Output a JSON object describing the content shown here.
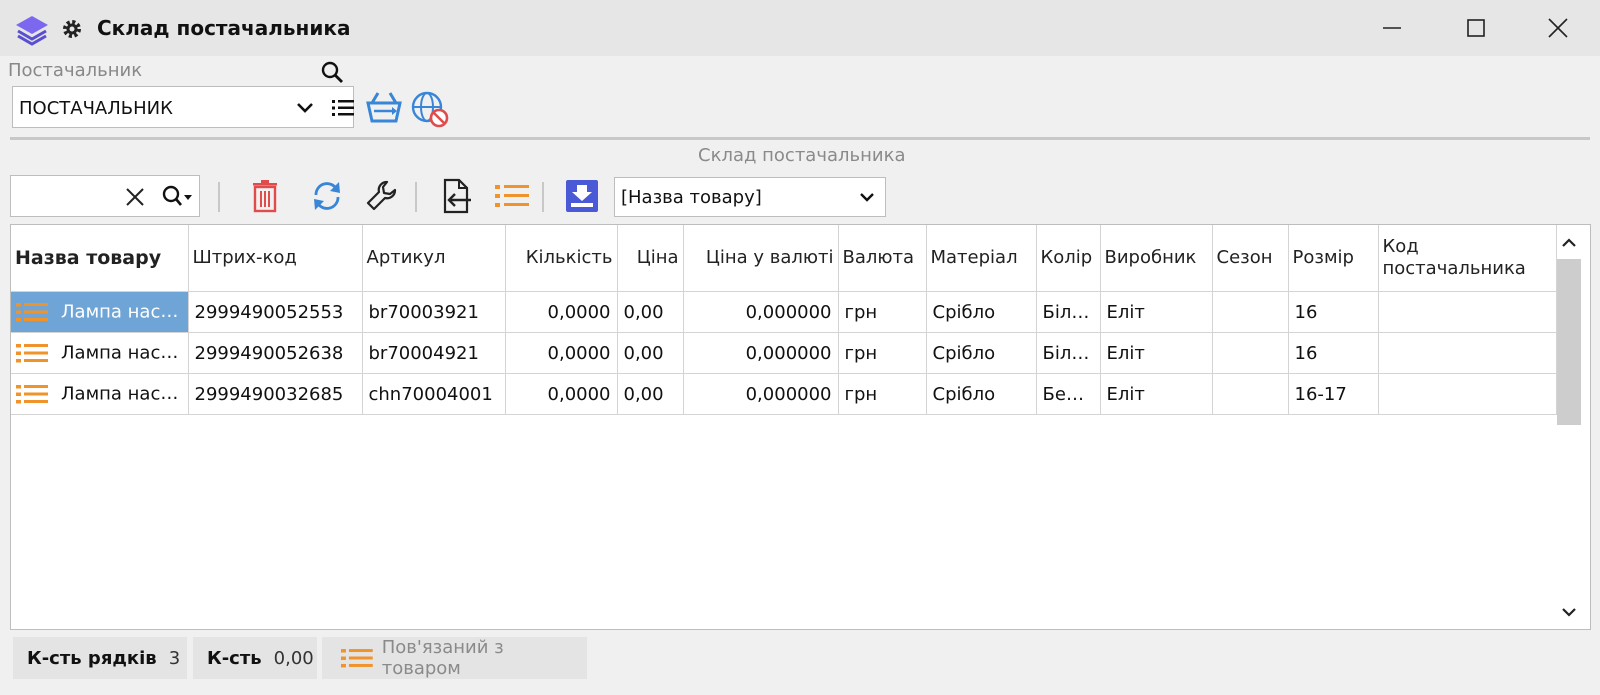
{
  "window": {
    "title": "Склад постачальника"
  },
  "supplier": {
    "label": "Постачальник",
    "value": "ПОСТАЧАЛЬНИК"
  },
  "section": {
    "title": "Склад постачальника"
  },
  "toolbar": {
    "search_value": "",
    "field_select": "[Назва товару]"
  },
  "table": {
    "columns": [
      "Назва товару",
      "Штрих-код",
      "Артикул",
      "Кількість",
      "Ціна",
      "Ціна у валюті",
      "Валюта",
      "Матеріал",
      "Колір",
      "Виробник",
      "Сезон",
      "Розмір",
      "Код постачальника"
    ],
    "rows": [
      [
        "Лампа настільна",
        "2999490052553",
        "br70003921",
        "0,0000",
        "0,00",
        "0,000000",
        "грн",
        "Срібло",
        "Білий",
        "Еліт",
        "",
        "16",
        ""
      ],
      [
        "Лампа настільна",
        "2999490052638",
        "br70004921",
        "0,0000",
        "0,00",
        "0,000000",
        "грн",
        "Срібло",
        "Білий",
        "Еліт",
        "",
        "16",
        ""
      ],
      [
        "Лампа настільна",
        "2999490032685",
        "chn70004001",
        "0,0000",
        "0,00",
        "0,000000",
        "грн",
        "Срібло",
        "Бежевий",
        "Еліт",
        "",
        "16-17",
        ""
      ]
    ]
  },
  "status": {
    "rows_label": "К-сть рядків",
    "rows_value": "3",
    "qty_label": "К-сть",
    "qty_value": "0,00",
    "linked_label": "Пов'язаний з товаром"
  },
  "colors": {
    "accent_orange": "#f0932b",
    "accent_blue": "#3a86d6",
    "delete_red": "#e04b4b",
    "selected_row": "#6fa5d6",
    "app_icon_purple": "#6a5acd"
  },
  "icons": [
    "app-layers-icon",
    "gear-icon",
    "minimize-icon",
    "maximize-icon",
    "close-icon",
    "search-icon",
    "chevron-down-icon",
    "list-icon",
    "basket-sync-icon",
    "globe-blocked-icon",
    "clear-icon",
    "search-dropdown-icon",
    "delete-icon",
    "refresh-icon",
    "wrench-icon",
    "import-icon",
    "list-orange-icon",
    "download-icon",
    "scroll-up-icon",
    "scroll-down-icon"
  ]
}
